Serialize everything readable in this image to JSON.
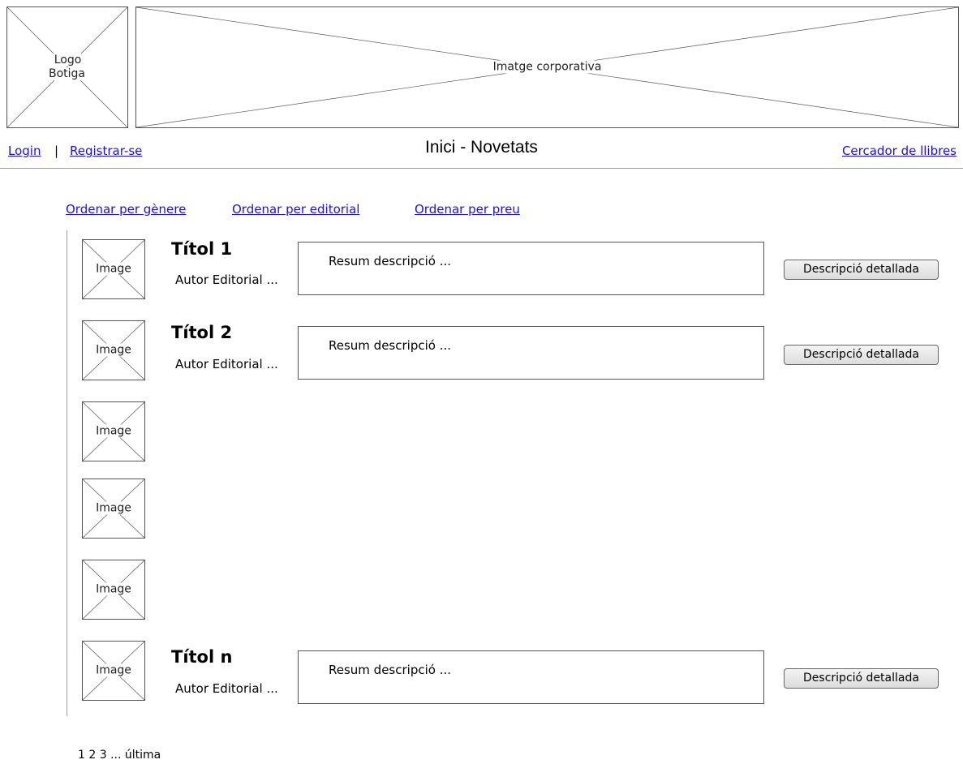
{
  "header": {
    "logo_label": "Logo\nBotiga",
    "banner_label": "Imatge corporativa"
  },
  "nav": {
    "login": "Login",
    "separator": "|",
    "register": "Registrar-se",
    "page_title": "Inici - Novetats",
    "search_link": "Cercador de llibres"
  },
  "sort": {
    "by_genre": "Ordenar per gènere",
    "by_publisher": "Ordenar per editorial",
    "by_price": "Ordenar per preu"
  },
  "books": [
    {
      "image_label": "Image",
      "title": "Títol 1",
      "meta": "Autor Editorial ...",
      "summary": "Resum descripció ...",
      "button": "Descripció detallada"
    },
    {
      "image_label": "Image",
      "title": "Títol 2",
      "meta": "Autor Editorial ...",
      "summary": "Resum descripció ...",
      "button": "Descripció detallada"
    },
    {
      "image_label": "Image"
    },
    {
      "image_label": "Image"
    },
    {
      "image_label": "Image"
    },
    {
      "image_label": "Image",
      "title": "Títol n",
      "meta": "Autor Editorial ...",
      "summary": "Resum descripció ...",
      "button": "Descripció detallada"
    }
  ],
  "pagination": "1 2 3 ... última"
}
